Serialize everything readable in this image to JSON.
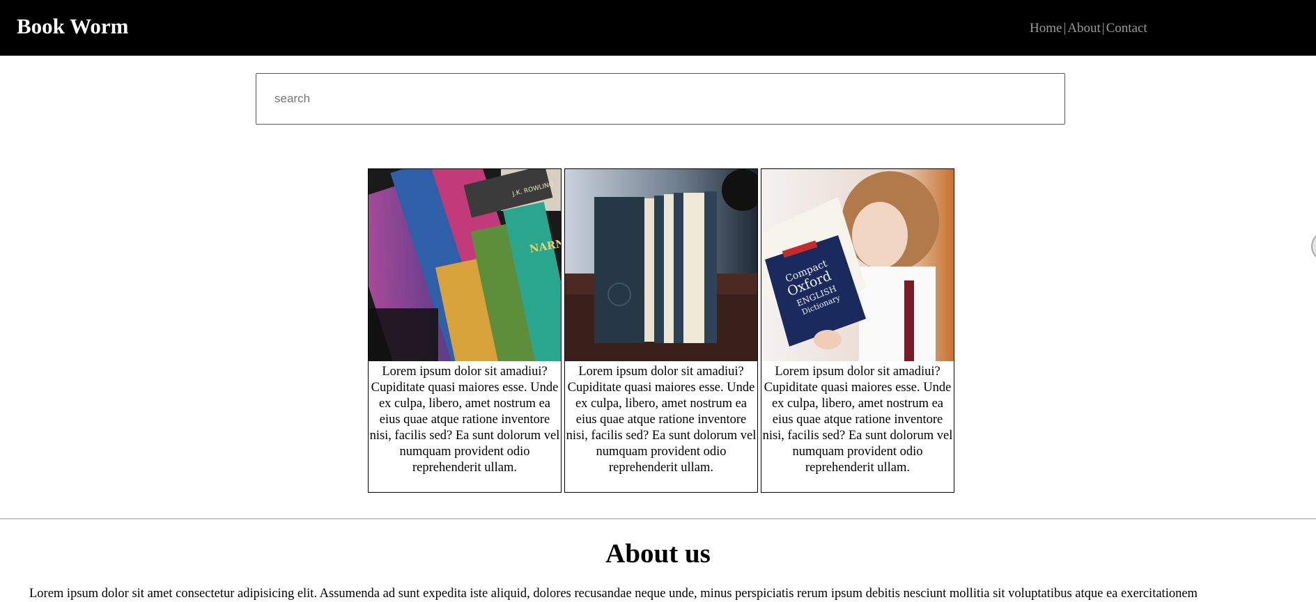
{
  "header": {
    "brand": "Book Worm",
    "nav": [
      {
        "label": "Home"
      },
      {
        "label": "About"
      },
      {
        "label": "Contact"
      }
    ],
    "separator": "|"
  },
  "search": {
    "placeholder": "search",
    "value": ""
  },
  "cards": [
    {
      "image": "stack of Harry Potter and Narnia books",
      "text": "Lorem ipsum dolor sit amadiui? Cupiditate quasi maiores esse. Unde ex culpa, libero, amet nostrum ea eius quae atque ratione inventore nisi, facilis sed? Ea sunt dolorum vel numquam provident odio reprehenderit ullam."
    },
    {
      "image": "three upright hardcover books",
      "text": "Lorem ipsum dolor sit amadiui? Cupiditate quasi maiores esse. Unde ex culpa, libero, amet nostrum ea eius quae atque ratione inventore nisi, facilis sed? Ea sunt dolorum vel numquam provident odio reprehenderit ullam."
    },
    {
      "image": "child reading Oxford English Dictionary",
      "text": "Lorem ipsum dolor sit amadiui? Cupiditate quasi maiores esse. Unde ex culpa, libero, amet nostrum ea eius quae atque ratione inventore nisi, facilis sed? Ea sunt dolorum vel numquam provident odio reprehenderit ullam."
    }
  ],
  "about": {
    "title": "About us",
    "text": "Lorem ipsum dolor sit amet consectetur adipisicing elit. Assumenda ad sunt expedita iste aliquid, dolores recusandae neque unde, minus perspiciatis rerum ipsum debitis nesciunt mollitia sit voluptatibus atque ea exercitationem"
  },
  "photo_text": {
    "book1_spine": "J.K. ROWLING",
    "book2_title": "NARNIA",
    "dict_line1": "Compact",
    "dict_line2": "Oxford",
    "dict_line3": "ENGLISH",
    "dict_line4": "Dictionary"
  },
  "colors": {
    "header_bg": "#000000",
    "brand_text": "#ffffff",
    "nav_text": "#9a9a9a"
  }
}
